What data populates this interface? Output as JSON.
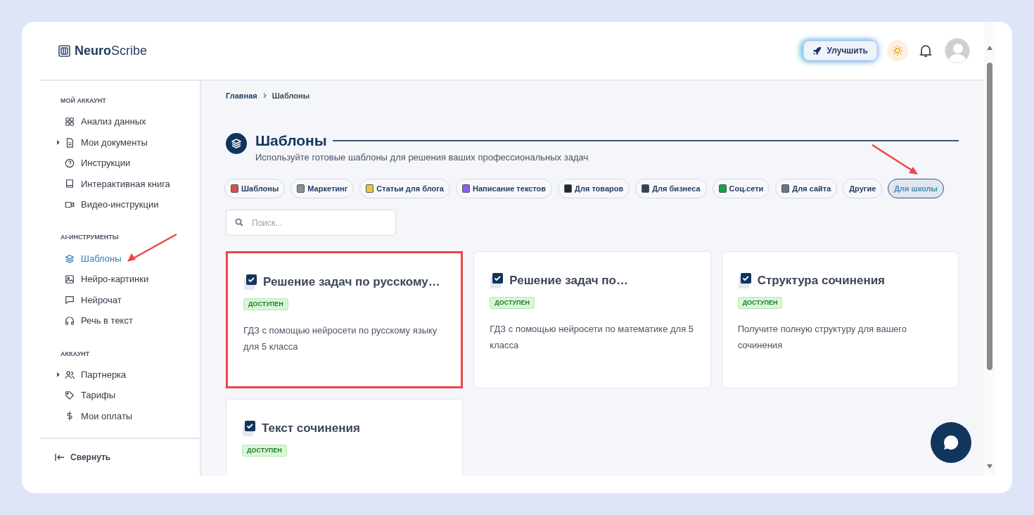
{
  "logo": {
    "bold": "Neuro",
    "light": "Scribe"
  },
  "header": {
    "upgrade_button": "Улучшить"
  },
  "sidebar": {
    "sections": [
      {
        "title": "МОЙ АККАУНТ",
        "items": [
          {
            "label": "Анализ данных",
            "expandable": false,
            "selected": false
          },
          {
            "label": "Мои документы",
            "expandable": true,
            "selected": false
          },
          {
            "label": "Инструкции",
            "expandable": false,
            "selected": false
          },
          {
            "label": "Интерактивная книга",
            "expandable": false,
            "selected": false
          },
          {
            "label": "Видео-инструкции",
            "expandable": false,
            "selected": false
          }
        ]
      },
      {
        "title": "AI-ИНСТРУМЕНТЫ",
        "items": [
          {
            "label": "Шаблоны",
            "expandable": false,
            "selected": true
          },
          {
            "label": "Нейро-картинки",
            "expandable": false,
            "selected": false
          },
          {
            "label": "Нейрочат",
            "expandable": false,
            "selected": false
          },
          {
            "label": "Речь в текст",
            "expandable": false,
            "selected": false
          }
        ]
      },
      {
        "title": "АККАУНТ",
        "items": [
          {
            "label": "Партнерка",
            "expandable": true,
            "selected": false
          },
          {
            "label": "Тарифы",
            "expandable": false,
            "selected": false
          },
          {
            "label": "Мои оплаты",
            "expandable": false,
            "selected": false
          }
        ]
      }
    ],
    "collapse": "Свернуть"
  },
  "breadcrumb": [
    "Главная",
    "Шаблоны"
  ],
  "page": {
    "title": "Шаблоны",
    "subtitle": "Используйте готовые шаблоны для решения ваших профессиональных задач"
  },
  "filters": [
    {
      "label": "Шаблоны",
      "icon": true,
      "selected": false
    },
    {
      "label": "Маркетинг",
      "icon": true,
      "selected": false
    },
    {
      "label": "Статьи для блога",
      "icon": true,
      "selected": false
    },
    {
      "label": "Написание текстов",
      "icon": true,
      "selected": false
    },
    {
      "label": "Для товаров",
      "icon": true,
      "selected": false
    },
    {
      "label": "Для бизнеса",
      "icon": true,
      "selected": false
    },
    {
      "label": "Соц.сети",
      "icon": true,
      "selected": false
    },
    {
      "label": "Для сайта",
      "icon": true,
      "selected": false
    },
    {
      "label": "Другие",
      "icon": false,
      "selected": false
    },
    {
      "label": "Для школы",
      "icon": false,
      "selected": true
    }
  ],
  "search": {
    "placeholder": "Поиск..."
  },
  "cards": [
    {
      "title": "Решение задач по русскому…",
      "badge": "ДОСТУПЕН",
      "description": "ГДЗ с помощью нейросети по русскому языку для 5 класса",
      "highlighted": true
    },
    {
      "title": "Решение задач по…",
      "badge": "ДОСТУПЕН",
      "description": "ГДЗ с помощью нейросети по математике для 5 класса",
      "highlighted": false
    },
    {
      "title": "Структура сочинения",
      "badge": "ДОСТУПЕН",
      "description": "Получите полную структуру для вашего сочинения",
      "highlighted": false
    },
    {
      "title": "Текст сочинения",
      "badge": "ДОСТУПЕН",
      "highlighted": false
    }
  ]
}
